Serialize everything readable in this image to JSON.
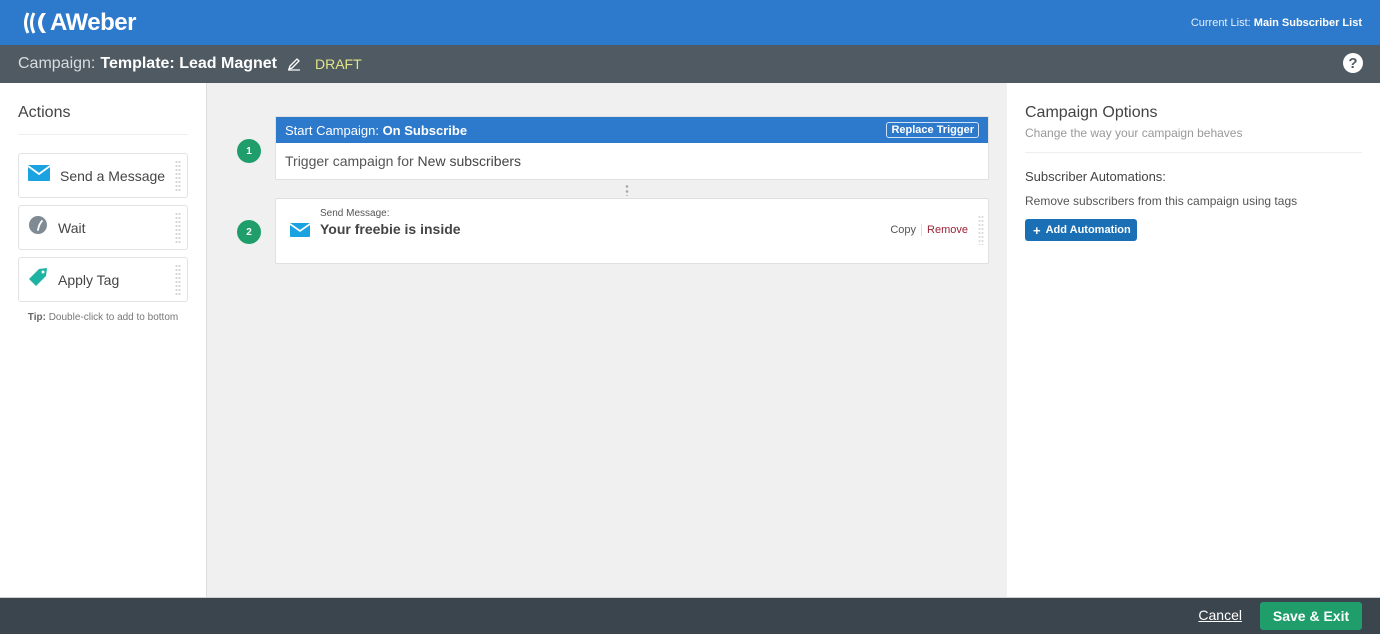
{
  "header": {
    "logo_text": "AWeber",
    "current_list_label": "Current List:",
    "current_list_value": "Main Subscriber List"
  },
  "campaign_bar": {
    "label": "Campaign:",
    "name": "Template: Lead Magnet",
    "status": "DRAFT",
    "help_icon": "?"
  },
  "sidebar": {
    "title": "Actions",
    "items": [
      {
        "label": "Send a Message",
        "icon": "envelope-icon"
      },
      {
        "label": "Wait",
        "icon": "clock-icon"
      },
      {
        "label": "Apply Tag",
        "icon": "tag-icon"
      }
    ],
    "tip_label": "Tip:",
    "tip_text": "Double-click to add to bottom"
  },
  "canvas": {
    "steps": [
      {
        "number": "1",
        "title_prefix": "Start Campaign:",
        "title_value": "On Subscribe",
        "button_label": "Replace Trigger",
        "body_prefix": "Trigger campaign for",
        "body_value": "New subscribers"
      },
      {
        "number": "2",
        "subtitle": "Send Message:",
        "title": "Your freebie is inside",
        "copy_label": "Copy",
        "remove_label": "Remove"
      }
    ]
  },
  "options": {
    "title": "Campaign Options",
    "subtitle": "Change the way your campaign behaves",
    "section_title": "Subscriber Automations:",
    "section_desc": "Remove subscribers from this campaign using tags",
    "add_button_label": "Add Automation",
    "add_button_icon": "+"
  },
  "footer": {
    "cancel_label": "Cancel",
    "save_label": "Save & Exit"
  },
  "colors": {
    "brand_blue": "#2d79cc",
    "campaign_bar": "#4f5a62",
    "draft_yellow": "#e1e58a",
    "step_green": "#1f9e6b",
    "remove_red": "#9b2235",
    "footer": "#3b454d"
  }
}
